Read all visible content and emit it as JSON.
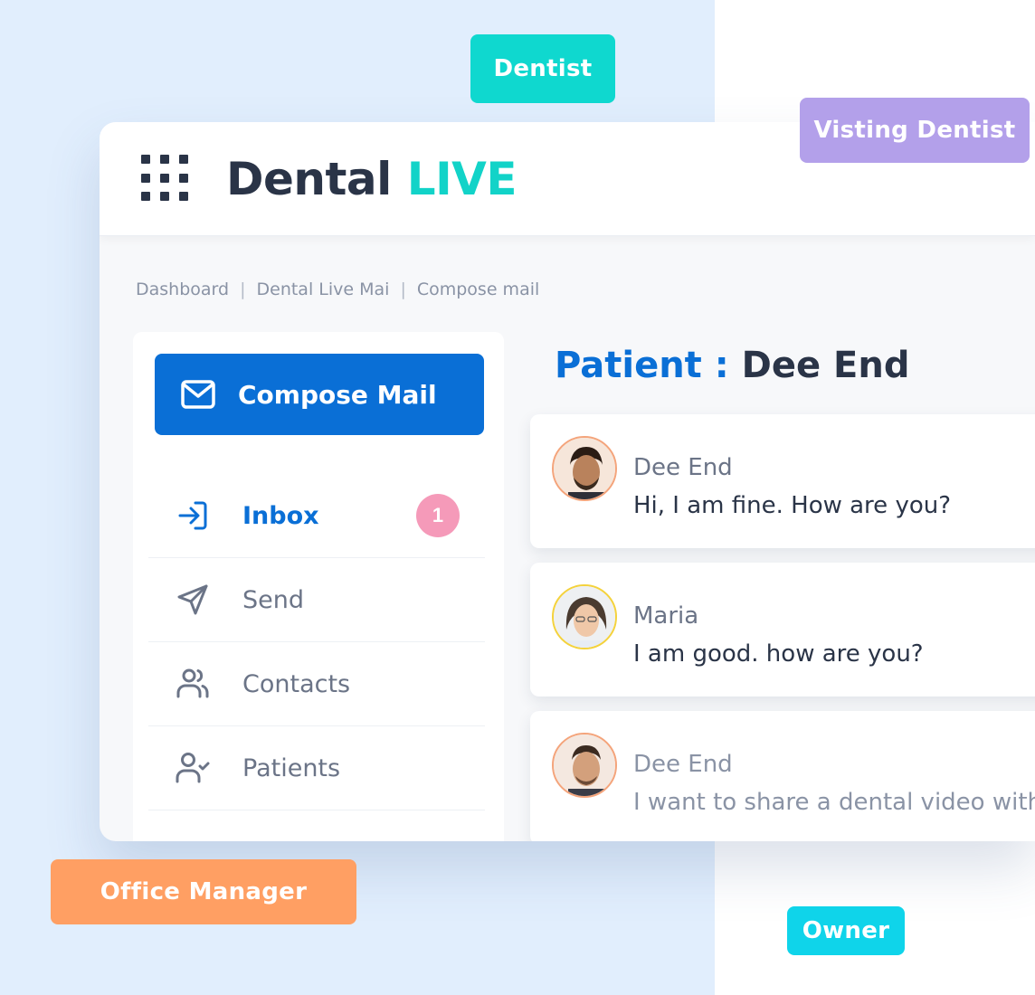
{
  "roles": {
    "dentist": "Dentist",
    "visiting_dentist": "Visting Dentist",
    "office_manager": "Office Manager",
    "owner": "Owner"
  },
  "header": {
    "logo_main": "Dental",
    "logo_accent": "LIVE",
    "menu_icon": "grid-icon"
  },
  "breadcrumb": [
    "Dashboard",
    "Dental Live Mai",
    "Compose mail"
  ],
  "sidebar": {
    "compose_label": "Compose Mail",
    "compose_icon": "mail-icon",
    "items": [
      {
        "label": "Inbox",
        "icon": "inbox-icon",
        "badge": "1",
        "active": true
      },
      {
        "label": "Send",
        "icon": "send-icon"
      },
      {
        "label": "Contacts",
        "icon": "contacts-icon"
      },
      {
        "label": "Patients",
        "icon": "patients-icon"
      }
    ]
  },
  "main": {
    "patient_label": "Patient :",
    "patient_name": "Dee End",
    "messages": [
      {
        "sender": "Dee End",
        "text": "Hi, I am fine. How are you?"
      },
      {
        "sender": "Maria",
        "text": "I am good. how are you?"
      },
      {
        "sender": "Dee End",
        "text": "I want to share a dental video with"
      }
    ]
  },
  "colors": {
    "primary": "#0a6fd6",
    "accent": "#12d3c8",
    "badge": "#f59ab9",
    "dentist_tag": "#0fd8cf",
    "visiting_tag": "#b3a0ea",
    "office_tag": "#ff9f63",
    "owner_tag": "#0fd4ea"
  }
}
